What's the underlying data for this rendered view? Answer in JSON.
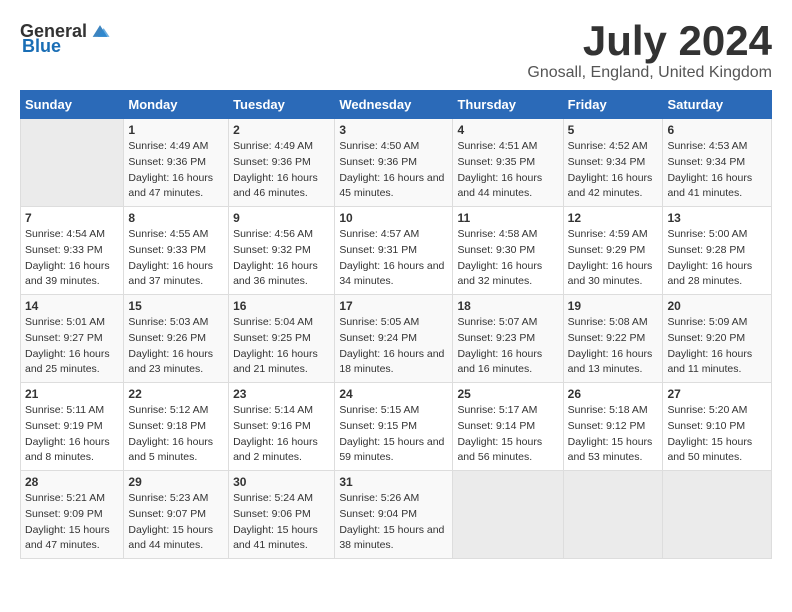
{
  "header": {
    "logo_general": "General",
    "logo_blue": "Blue",
    "month_title": "July 2024",
    "location": "Gnosall, England, United Kingdom"
  },
  "days_of_week": [
    "Sunday",
    "Monday",
    "Tuesday",
    "Wednesday",
    "Thursday",
    "Friday",
    "Saturday"
  ],
  "weeks": [
    [
      {
        "day": "",
        "sunrise": "",
        "sunset": "",
        "daylight": ""
      },
      {
        "day": "1",
        "sunrise": "Sunrise: 4:49 AM",
        "sunset": "Sunset: 9:36 PM",
        "daylight": "Daylight: 16 hours and 47 minutes."
      },
      {
        "day": "2",
        "sunrise": "Sunrise: 4:49 AM",
        "sunset": "Sunset: 9:36 PM",
        "daylight": "Daylight: 16 hours and 46 minutes."
      },
      {
        "day": "3",
        "sunrise": "Sunrise: 4:50 AM",
        "sunset": "Sunset: 9:36 PM",
        "daylight": "Daylight: 16 hours and 45 minutes."
      },
      {
        "day": "4",
        "sunrise": "Sunrise: 4:51 AM",
        "sunset": "Sunset: 9:35 PM",
        "daylight": "Daylight: 16 hours and 44 minutes."
      },
      {
        "day": "5",
        "sunrise": "Sunrise: 4:52 AM",
        "sunset": "Sunset: 9:34 PM",
        "daylight": "Daylight: 16 hours and 42 minutes."
      },
      {
        "day": "6",
        "sunrise": "Sunrise: 4:53 AM",
        "sunset": "Sunset: 9:34 PM",
        "daylight": "Daylight: 16 hours and 41 minutes."
      }
    ],
    [
      {
        "day": "7",
        "sunrise": "Sunrise: 4:54 AM",
        "sunset": "Sunset: 9:33 PM",
        "daylight": "Daylight: 16 hours and 39 minutes."
      },
      {
        "day": "8",
        "sunrise": "Sunrise: 4:55 AM",
        "sunset": "Sunset: 9:33 PM",
        "daylight": "Daylight: 16 hours and 37 minutes."
      },
      {
        "day": "9",
        "sunrise": "Sunrise: 4:56 AM",
        "sunset": "Sunset: 9:32 PM",
        "daylight": "Daylight: 16 hours and 36 minutes."
      },
      {
        "day": "10",
        "sunrise": "Sunrise: 4:57 AM",
        "sunset": "Sunset: 9:31 PM",
        "daylight": "Daylight: 16 hours and 34 minutes."
      },
      {
        "day": "11",
        "sunrise": "Sunrise: 4:58 AM",
        "sunset": "Sunset: 9:30 PM",
        "daylight": "Daylight: 16 hours and 32 minutes."
      },
      {
        "day": "12",
        "sunrise": "Sunrise: 4:59 AM",
        "sunset": "Sunset: 9:29 PM",
        "daylight": "Daylight: 16 hours and 30 minutes."
      },
      {
        "day": "13",
        "sunrise": "Sunrise: 5:00 AM",
        "sunset": "Sunset: 9:28 PM",
        "daylight": "Daylight: 16 hours and 28 minutes."
      }
    ],
    [
      {
        "day": "14",
        "sunrise": "Sunrise: 5:01 AM",
        "sunset": "Sunset: 9:27 PM",
        "daylight": "Daylight: 16 hours and 25 minutes."
      },
      {
        "day": "15",
        "sunrise": "Sunrise: 5:03 AM",
        "sunset": "Sunset: 9:26 PM",
        "daylight": "Daylight: 16 hours and 23 minutes."
      },
      {
        "day": "16",
        "sunrise": "Sunrise: 5:04 AM",
        "sunset": "Sunset: 9:25 PM",
        "daylight": "Daylight: 16 hours and 21 minutes."
      },
      {
        "day": "17",
        "sunrise": "Sunrise: 5:05 AM",
        "sunset": "Sunset: 9:24 PM",
        "daylight": "Daylight: 16 hours and 18 minutes."
      },
      {
        "day": "18",
        "sunrise": "Sunrise: 5:07 AM",
        "sunset": "Sunset: 9:23 PM",
        "daylight": "Daylight: 16 hours and 16 minutes."
      },
      {
        "day": "19",
        "sunrise": "Sunrise: 5:08 AM",
        "sunset": "Sunset: 9:22 PM",
        "daylight": "Daylight: 16 hours and 13 minutes."
      },
      {
        "day": "20",
        "sunrise": "Sunrise: 5:09 AM",
        "sunset": "Sunset: 9:20 PM",
        "daylight": "Daylight: 16 hours and 11 minutes."
      }
    ],
    [
      {
        "day": "21",
        "sunrise": "Sunrise: 5:11 AM",
        "sunset": "Sunset: 9:19 PM",
        "daylight": "Daylight: 16 hours and 8 minutes."
      },
      {
        "day": "22",
        "sunrise": "Sunrise: 5:12 AM",
        "sunset": "Sunset: 9:18 PM",
        "daylight": "Daylight: 16 hours and 5 minutes."
      },
      {
        "day": "23",
        "sunrise": "Sunrise: 5:14 AM",
        "sunset": "Sunset: 9:16 PM",
        "daylight": "Daylight: 16 hours and 2 minutes."
      },
      {
        "day": "24",
        "sunrise": "Sunrise: 5:15 AM",
        "sunset": "Sunset: 9:15 PM",
        "daylight": "Daylight: 15 hours and 59 minutes."
      },
      {
        "day": "25",
        "sunrise": "Sunrise: 5:17 AM",
        "sunset": "Sunset: 9:14 PM",
        "daylight": "Daylight: 15 hours and 56 minutes."
      },
      {
        "day": "26",
        "sunrise": "Sunrise: 5:18 AM",
        "sunset": "Sunset: 9:12 PM",
        "daylight": "Daylight: 15 hours and 53 minutes."
      },
      {
        "day": "27",
        "sunrise": "Sunrise: 5:20 AM",
        "sunset": "Sunset: 9:10 PM",
        "daylight": "Daylight: 15 hours and 50 minutes."
      }
    ],
    [
      {
        "day": "28",
        "sunrise": "Sunrise: 5:21 AM",
        "sunset": "Sunset: 9:09 PM",
        "daylight": "Daylight: 15 hours and 47 minutes."
      },
      {
        "day": "29",
        "sunrise": "Sunrise: 5:23 AM",
        "sunset": "Sunset: 9:07 PM",
        "daylight": "Daylight: 15 hours and 44 minutes."
      },
      {
        "day": "30",
        "sunrise": "Sunrise: 5:24 AM",
        "sunset": "Sunset: 9:06 PM",
        "daylight": "Daylight: 15 hours and 41 minutes."
      },
      {
        "day": "31",
        "sunrise": "Sunrise: 5:26 AM",
        "sunset": "Sunset: 9:04 PM",
        "daylight": "Daylight: 15 hours and 38 minutes."
      },
      {
        "day": "",
        "sunrise": "",
        "sunset": "",
        "daylight": ""
      },
      {
        "day": "",
        "sunrise": "",
        "sunset": "",
        "daylight": ""
      },
      {
        "day": "",
        "sunrise": "",
        "sunset": "",
        "daylight": ""
      }
    ]
  ]
}
